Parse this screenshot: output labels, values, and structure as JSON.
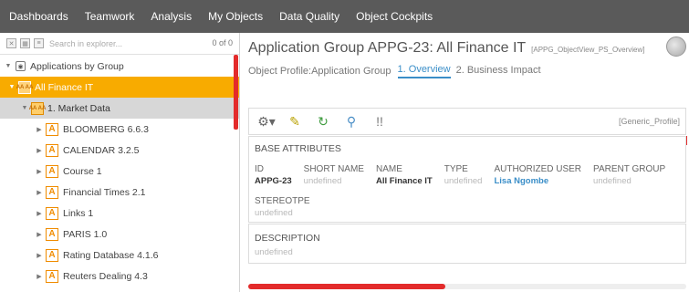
{
  "topnav": {
    "items": [
      "Dashboards",
      "Teamwork",
      "Analysis",
      "My Objects",
      "Data Quality",
      "Object Cockpits"
    ]
  },
  "explorer": {
    "search_placeholder": "Search in explorer...",
    "count": "0 of 0",
    "tree": [
      {
        "label": "Applications by Group",
        "level": 0,
        "icon": "group-icon",
        "expanded": true
      },
      {
        "label": "All Finance IT",
        "level": 1,
        "icon": "application-group-icon",
        "selected": true
      },
      {
        "label": "1. Market Data",
        "level": 2,
        "icon": "application-group-icon"
      },
      {
        "label": "BLOOMBERG 6.6.3",
        "level": 3,
        "icon": "application-icon"
      },
      {
        "label": "CALENDAR 3.2.5",
        "level": 3,
        "icon": "application-icon"
      },
      {
        "label": "Course 1",
        "level": 3,
        "icon": "application-icon"
      },
      {
        "label": "Financial Times 2.1",
        "level": 3,
        "icon": "application-icon"
      },
      {
        "label": "Links 1",
        "level": 3,
        "icon": "application-icon"
      },
      {
        "label": "PARIS 1.0",
        "level": 3,
        "icon": "application-icon"
      },
      {
        "label": "Rating Database 4.1.6",
        "level": 3,
        "icon": "application-icon"
      },
      {
        "label": "Reuters Dealing 4.3",
        "level": 3,
        "icon": "application-icon"
      }
    ],
    "aa_glyph": "AA AA",
    "a_glyph": "A"
  },
  "header": {
    "title": "Application Group APPG-23: All Finance IT",
    "view_code": "[APPG_ObjectView_PS_Overview]",
    "breadcrumb": "Object Profile:Application Group",
    "tabs": [
      {
        "label": "1. Overview",
        "active": true
      },
      {
        "label": "2. Business Impact",
        "active": false
      }
    ]
  },
  "toolbar": {
    "icons": [
      "settings-icon",
      "edit-icon",
      "refresh-icon",
      "pin-icon",
      "marker-icon"
    ],
    "profile": "[Generic_Profile]"
  },
  "attributes": {
    "section_title": "BASE ATTRIBUTES",
    "columns": [
      {
        "head": "ID",
        "value": "APPG-23",
        "style": "strong"
      },
      {
        "head": "SHORT NAME",
        "value": "undefined",
        "style": "muted"
      },
      {
        "head": "NAME",
        "value": "All Finance IT",
        "style": "strong"
      },
      {
        "head": "TYPE",
        "value": "undefined",
        "style": "muted"
      },
      {
        "head": "AUTHORIZED USER",
        "value": "Lisa Ngombe",
        "style": "link"
      },
      {
        "head": "PARENT GROUP",
        "value": "undefined",
        "style": "muted"
      }
    ],
    "stereotype_head": "STEREOTPE",
    "stereotype_value": "undefined"
  },
  "description": {
    "title": "DESCRIPTION",
    "value": "undefined"
  },
  "colors": {
    "nav_bg": "#5a5a5a",
    "selected_bg": "#f8ab00",
    "accent": "#3a8ec8",
    "scroll_red": "#e32b2b"
  },
  "scroll": {
    "horizontal_thumb_fraction": 0.45
  }
}
